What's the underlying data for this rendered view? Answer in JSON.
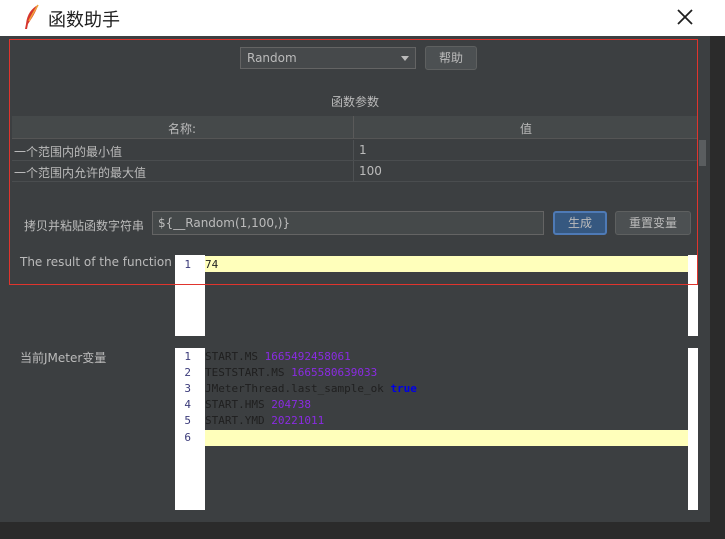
{
  "window": {
    "title": "函数助手",
    "close_icon": "close-icon",
    "app_icon": "feather-icon"
  },
  "function_select": {
    "selected": "Random",
    "help_label": "帮助"
  },
  "params": {
    "section_title": "函数参数",
    "col_name": "名称:",
    "col_value": "值",
    "rows": [
      {
        "name": "一个范围内的最小值",
        "value": "1"
      },
      {
        "name": "一个范围内允许的最大值",
        "value": "100"
      }
    ]
  },
  "copy_paste": {
    "label": "拷贝并粘贴函数字符串",
    "value": "${__Random(1,100,)}",
    "generate_label": "生成",
    "reset_label": "重置变量"
  },
  "result": {
    "label": "The result of the function is",
    "lines": [
      {
        "n": "1",
        "text": "74"
      }
    ]
  },
  "jmeter_vars": {
    "label": "当前JMeter变量",
    "lines": [
      {
        "n": "1",
        "key": "START.MS ",
        "val": "1665492458061"
      },
      {
        "n": "2",
        "key": "TESTSTART.MS ",
        "val": "1665580639033"
      },
      {
        "n": "3",
        "key": "JMeterThread.last_sample_ok ",
        "val": "true"
      },
      {
        "n": "4",
        "key": "START.HMS ",
        "val": "204738"
      },
      {
        "n": "5",
        "key": "START.YMD ",
        "val": "20221011"
      },
      {
        "n": "6",
        "key": "",
        "val": ""
      }
    ]
  },
  "colors": {
    "highlight": "#ffffbb",
    "number": "#8a2be2",
    "keyword": "#0000e6",
    "annotation": "#e0342d"
  }
}
